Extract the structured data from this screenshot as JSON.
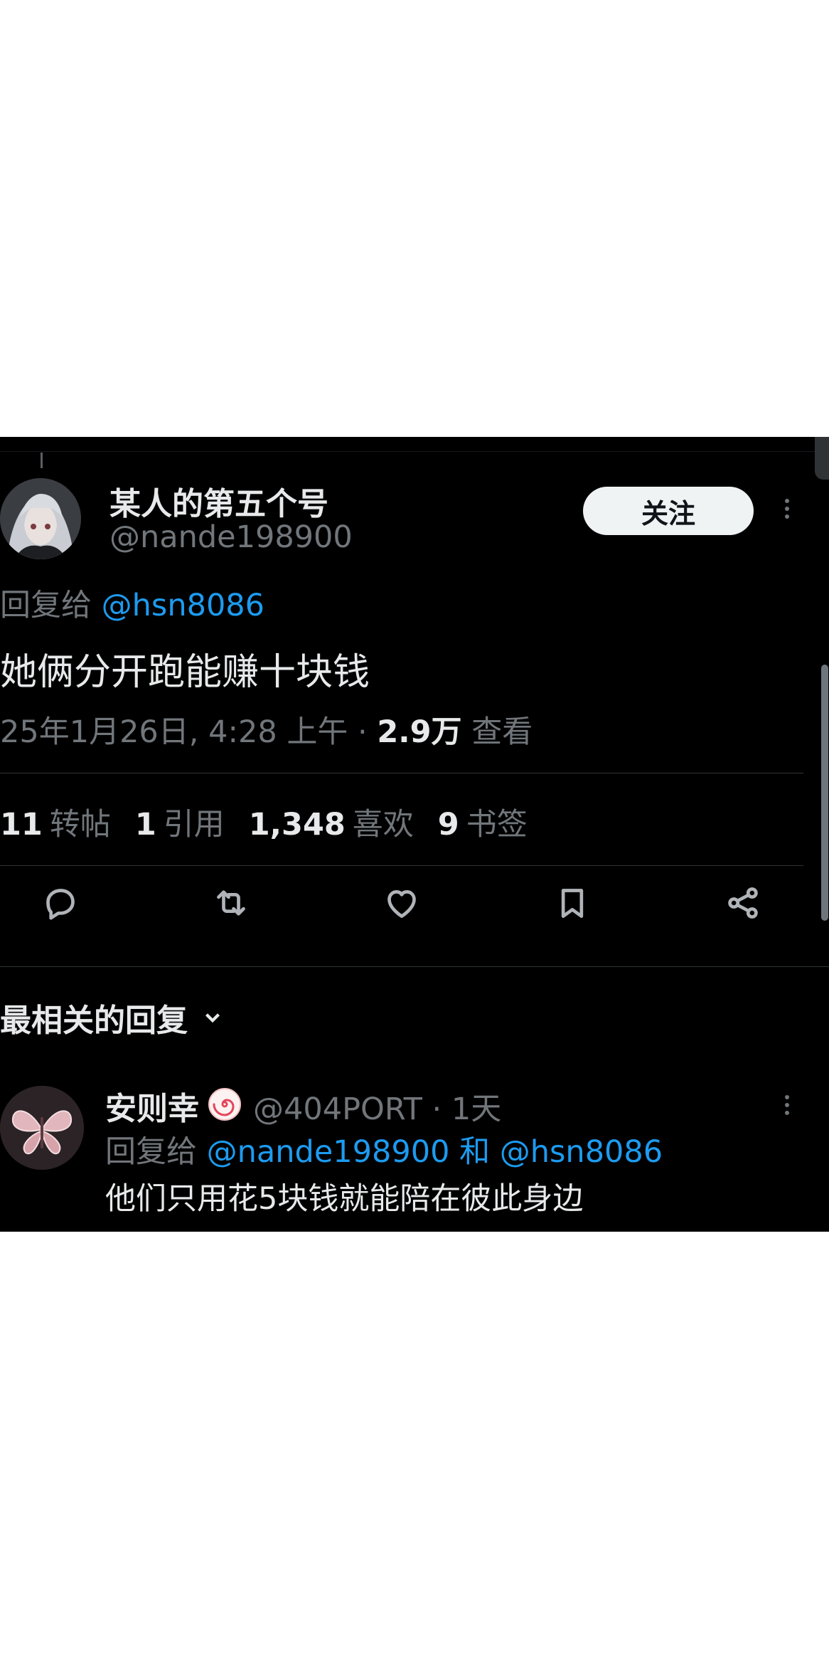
{
  "tweet": {
    "author_name": "某人的第五个号",
    "author_handle": "@nande198900",
    "follow_label": "关注",
    "reply_to_label": "回复给",
    "reply_to_handle": "@hsn8086",
    "text": "她俩分开跑能赚十块钱",
    "timestamp": "25年1月26日, 4:28 上午",
    "separator": "·",
    "views_count": "2.9万",
    "views_label": "查看"
  },
  "stats": [
    {
      "count": "11",
      "label": "转帖"
    },
    {
      "count": "1",
      "label": "引用"
    },
    {
      "count": "1,348",
      "label": "喜欢"
    },
    {
      "count": "9",
      "label": "书签"
    }
  ],
  "actions": [
    {
      "icon": "reply-icon"
    },
    {
      "icon": "retweet-icon"
    },
    {
      "icon": "like-icon"
    },
    {
      "icon": "bookmark-icon"
    },
    {
      "icon": "share-icon"
    }
  ],
  "replies_sort": {
    "label": "最相关的回复",
    "icon": "chevron-down-icon"
  },
  "reply": {
    "name": "安则幸",
    "badge_icon": "naruto-swirl-icon",
    "handle": "@404PORT",
    "separator": "·",
    "time": "1天",
    "reply_to_label": "回复给",
    "reply_to_1": "@nande198900",
    "conjunction": "和",
    "reply_to_2": "@hsn8086",
    "text": "他们只用花5块钱就能陪在彼此身边"
  },
  "colors": {
    "background": "#000000",
    "primary_text": "#e7e9ea",
    "secondary_text": "#71767b",
    "link": "#1d9bf0",
    "follow_button_bg": "#eff3f4"
  }
}
